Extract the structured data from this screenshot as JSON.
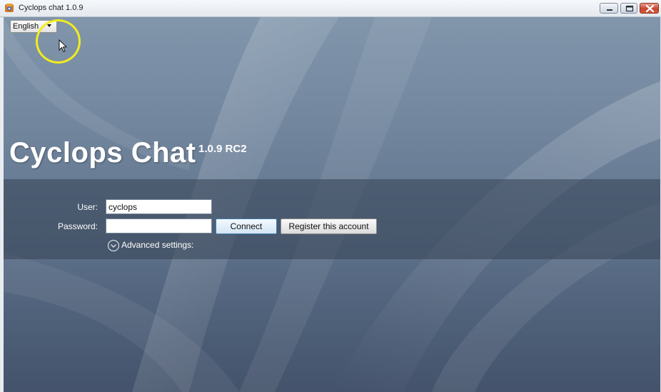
{
  "window": {
    "title": "Cyclops chat 1.0.9",
    "app_icon": "cyclops-app-icon",
    "controls": {
      "minimize_icon": "minimize-icon",
      "maximize_icon": "maximize-icon",
      "close_icon": "close-icon"
    }
  },
  "language": {
    "selected": "English",
    "icon": "dropdown-arrow-icon"
  },
  "brand": {
    "name": "Cyclops Chat",
    "version": "1.0.9 RC2"
  },
  "login": {
    "user_label": "User:",
    "user_value": "cyclops",
    "password_label": "Password:",
    "password_value": "",
    "connect_label": "Connect",
    "register_label": "Register this account",
    "advanced_label": "Advanced settings:",
    "advanced_icon": "expand-chevron-icon"
  },
  "colors": {
    "highlight_ring": "#f2ec1d",
    "connect_border": "#3c7fb1",
    "close_button": "#c7442c"
  }
}
